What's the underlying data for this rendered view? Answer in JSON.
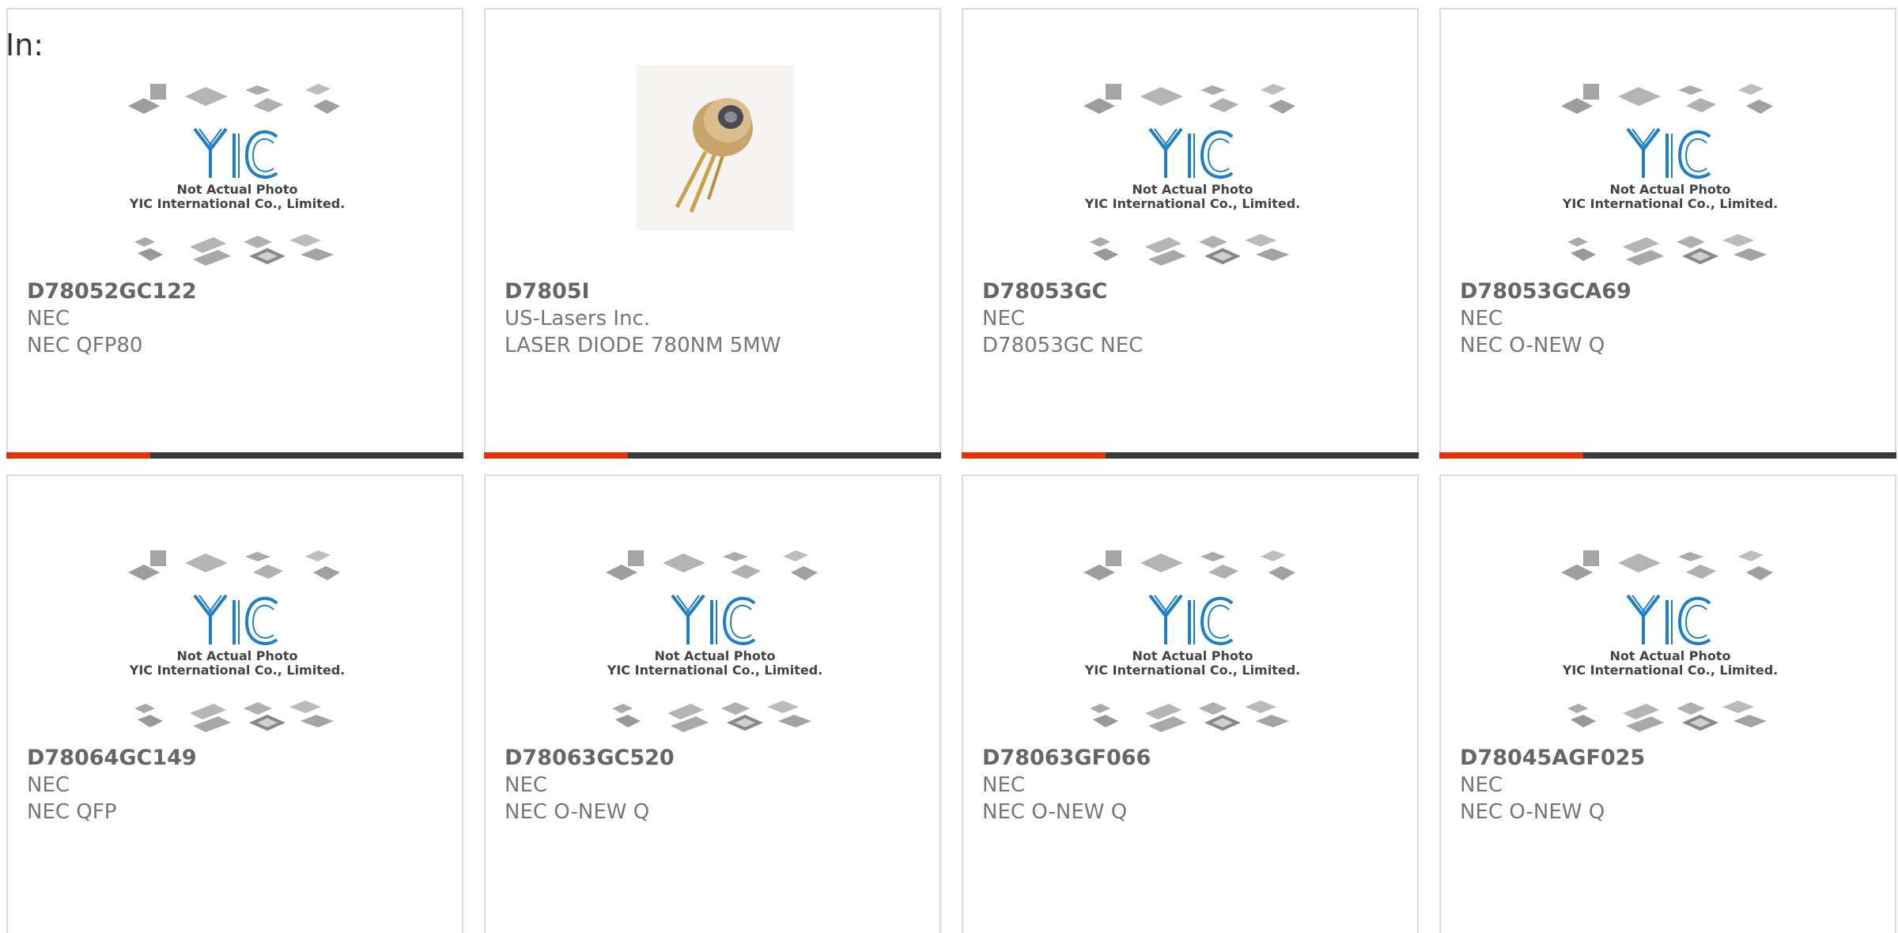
{
  "header": {
    "label": "In:"
  },
  "placeholder_image": {
    "line1": "Not Actual Photo",
    "line2": "YIC International Co., Limited.",
    "logo_text": "YIC"
  },
  "colors": {
    "accent": "#e0330c",
    "bar": "#3a3a3a",
    "logo_blue": "#1e7ec8"
  },
  "products": [
    {
      "part": "D78052GC122",
      "manufacturer": "NEC",
      "description": "NEC QFP80",
      "image": "placeholder"
    },
    {
      "part": "D7805I",
      "manufacturer": "US-Lasers Inc.",
      "description": "LASER DIODE 780NM 5MW",
      "image": "laser-diode-photo"
    },
    {
      "part": "D78053GC",
      "manufacturer": "NEC",
      "description": "D78053GC NEC",
      "image": "placeholder"
    },
    {
      "part": "D78053GCA69",
      "manufacturer": "NEC",
      "description": "NEC O-NEW Q",
      "image": "placeholder"
    },
    {
      "part": "D78064GC149",
      "manufacturer": "NEC",
      "description": "NEC QFP",
      "image": "placeholder"
    },
    {
      "part": "D78063GC520",
      "manufacturer": "NEC",
      "description": "NEC O-NEW Q",
      "image": "placeholder"
    },
    {
      "part": "D78063GF066",
      "manufacturer": "NEC",
      "description": "NEC O-NEW Q",
      "image": "placeholder"
    },
    {
      "part": "D78045AGF025",
      "manufacturer": "NEC",
      "description": "NEC O-NEW Q",
      "image": "placeholder"
    }
  ]
}
